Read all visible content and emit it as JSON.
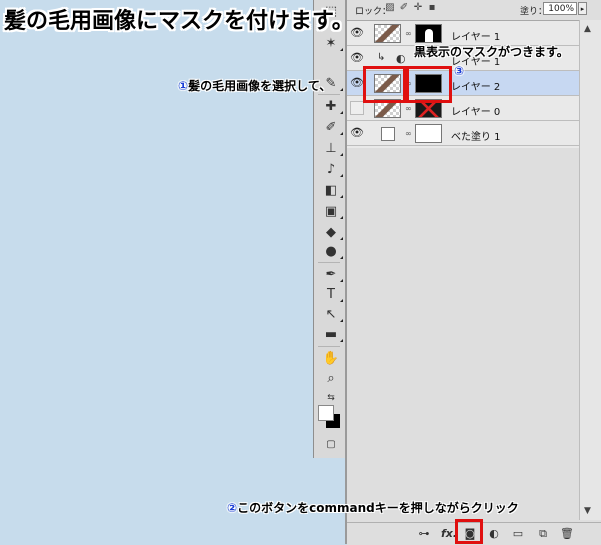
{
  "title": "髪の毛用画像にマスクを付けます。",
  "annotations": {
    "step1": {
      "number": "①",
      "text": "髪の毛用画像を選択して、"
    },
    "step2": {
      "number": "②",
      "text": "このボタンをcommandキーを押しながらクリック"
    },
    "step3": {
      "number": "③",
      "text": "黒表示のマスクがつきます。"
    }
  },
  "layers_panel": {
    "lock_label": "ロック：",
    "fill_label": "塗り：",
    "fill_value": "100%",
    "layers": [
      {
        "name": "レイヤー 1",
        "visible": true,
        "mask": "person",
        "selected": false
      },
      {
        "name": "レイヤー 1",
        "visible": true,
        "adjustment": true,
        "selected": false
      },
      {
        "name": "レイヤー 2",
        "visible": true,
        "mask": "black",
        "selected": true
      },
      {
        "name": "レイヤー 0",
        "visible": false,
        "mask": "x",
        "selected": false
      },
      {
        "name": "べた塗り 1",
        "visible": true,
        "fill": true,
        "selected": false
      }
    ]
  },
  "toolbox": {
    "tools": [
      "magic-wand-icon",
      "eyedropper-icon",
      "healing-brush-icon",
      "brush-icon",
      "stamp-icon",
      "history-brush-icon",
      "eraser-icon",
      "gradient-icon",
      "blur-icon",
      "dodge-icon",
      "pen-icon",
      "type-icon",
      "path-select-icon",
      "rectangle-icon",
      "hand-icon",
      "zoom-icon"
    ]
  },
  "bottom_bar": {
    "icons": [
      "link-icon",
      "fx-icon",
      "add-mask-icon",
      "adjustment-icon",
      "group-icon",
      "new-layer-icon",
      "trash-icon"
    ],
    "fx_label": "fx."
  },
  "colors": {
    "accent_red": "#e01010",
    "number_blue": "#1a3dd6",
    "selected_row": "#c7d8f2",
    "background": "#c7dcec"
  }
}
